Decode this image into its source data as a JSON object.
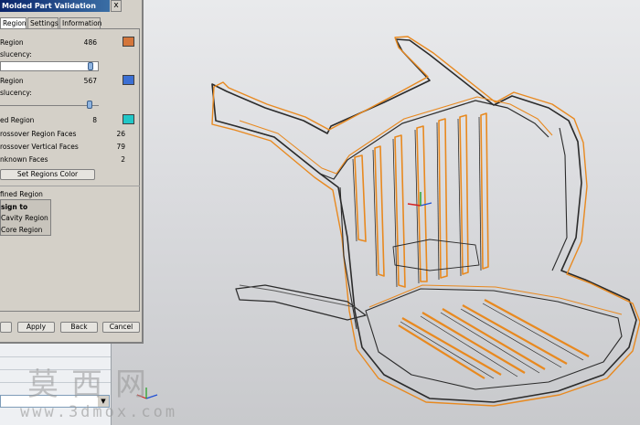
{
  "dialog": {
    "title": "Molded Part Validation",
    "close_glyph": "x",
    "tabs": [
      {
        "label": "Region"
      },
      {
        "label": "Settings"
      },
      {
        "label": "Information"
      }
    ],
    "region_a": {
      "label": "Region",
      "count": "486",
      "color": "#d4763b"
    },
    "translucency_a": "slucency:",
    "region_b": {
      "label": "Region",
      "count": "567",
      "color": "#3b6fd4"
    },
    "translucency_b": "slucency:",
    "region_c": {
      "label": "ed Region",
      "count": "8",
      "color": "#21c7c7"
    },
    "crossover_region": {
      "label": "rossover Region Faces",
      "count": "26"
    },
    "crossover_vertical": {
      "label": "rossover Vertical Faces",
      "count": "79"
    },
    "unknown_faces": {
      "label": "nknown Faces",
      "count": "2"
    },
    "set_regions_color": "Set Regions Color",
    "undefined_region": "fined Region",
    "assign_to": "sign to",
    "cavity_region": "Cavity Region",
    "core_region": "Core Region",
    "apply": "Apply",
    "back": "Back",
    "cancel": "Cancel"
  },
  "watermark": {
    "text": "莫西网",
    "url": "www.3dmox.com"
  },
  "colors": {
    "edge_orange": "#e8891f",
    "edge_dark": "#2b2b2b",
    "dialog_bg": "#d4d0c8",
    "title_blue": "#0a246a"
  }
}
